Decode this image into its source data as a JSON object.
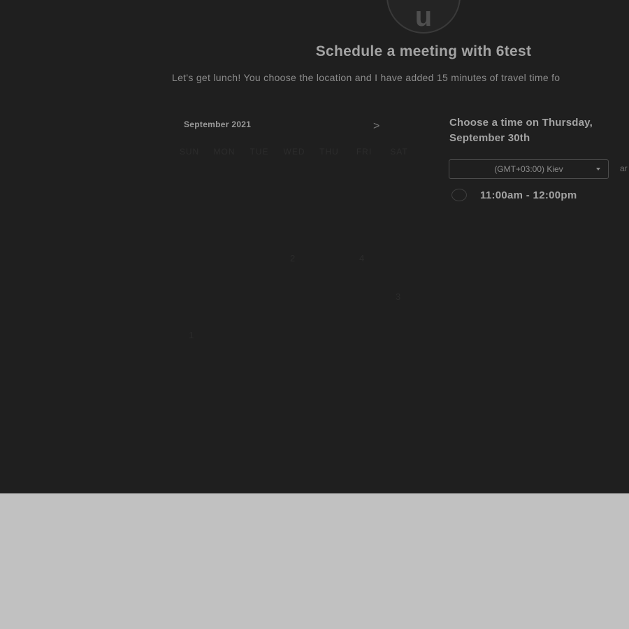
{
  "host": {
    "avatar_initial": "u",
    "title": "Schedule a meeting with 6test",
    "description": "Let's get lunch! You choose the location and I have added 15 minutes of travel time fo"
  },
  "calendar": {
    "month_label": "September 2021",
    "next_icon": ">",
    "weekdays": [
      "SUN",
      "MON",
      "TUE",
      "WED",
      "THU",
      "FRI",
      "SAT"
    ],
    "faint_days": [
      "2",
      "4",
      "3",
      "1"
    ]
  },
  "times": {
    "heading": "Choose a time on Thursday, September 30th",
    "timezone": "(GMT+03:00) Kiev",
    "side_text": "ar",
    "slots": [
      {
        "label": "11:00am - 12:00pm"
      }
    ]
  },
  "colors": {
    "panel_bg": "#1f1f1f",
    "page_bg": "#c1c1c1",
    "text_primary": "#a3a3a3"
  }
}
